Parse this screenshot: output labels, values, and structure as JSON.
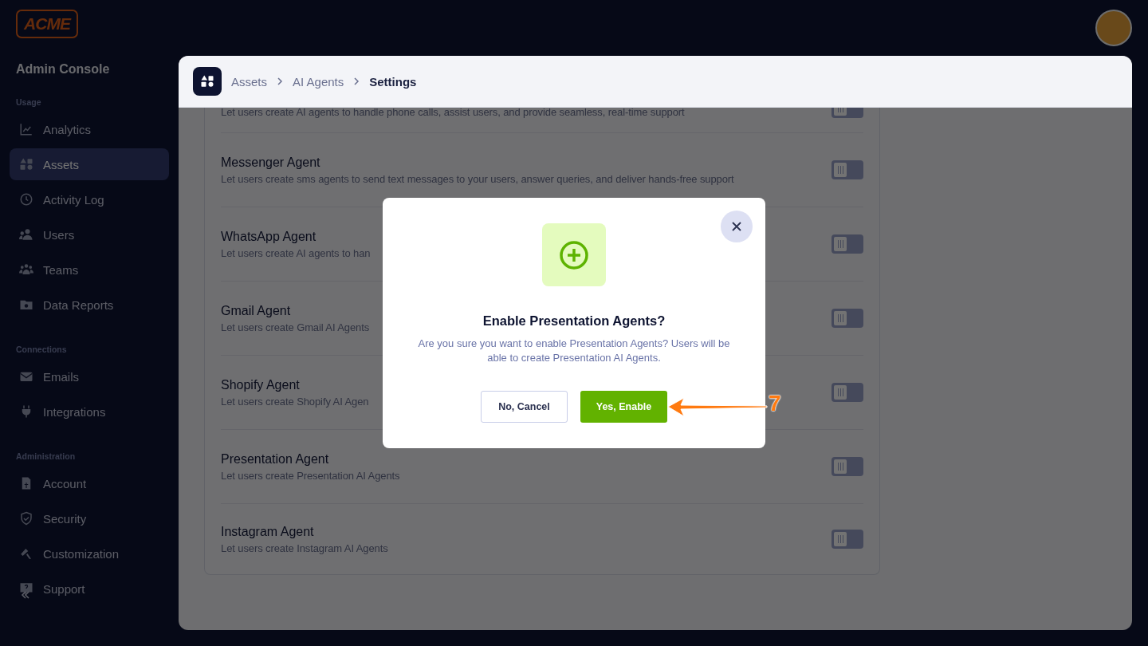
{
  "logo": {
    "text": "ACME"
  },
  "sidebar": {
    "title": "Admin Console",
    "sections": [
      {
        "heading": "Usage",
        "items": [
          {
            "label": "Analytics",
            "selected": false
          },
          {
            "label": "Assets",
            "selected": true
          },
          {
            "label": "Activity Log",
            "selected": false
          },
          {
            "label": "Users",
            "selected": false
          },
          {
            "label": "Teams",
            "selected": false
          },
          {
            "label": "Data Reports",
            "selected": false
          }
        ]
      },
      {
        "heading": "Connections",
        "items": [
          {
            "label": "Emails",
            "selected": false
          },
          {
            "label": "Integrations",
            "selected": false
          }
        ]
      },
      {
        "heading": "Administration",
        "items": [
          {
            "label": "Account",
            "selected": false
          },
          {
            "label": "Security",
            "selected": false
          },
          {
            "label": "Customization",
            "selected": false
          },
          {
            "label": "Support",
            "selected": false
          }
        ]
      }
    ]
  },
  "breadcrumb": [
    {
      "label": "Assets",
      "current": false
    },
    {
      "label": "AI Agents",
      "current": false
    },
    {
      "label": "Settings",
      "current": true
    }
  ],
  "agents": [
    {
      "description": "Let users create AI agents to handle phone calls, assist users, and provide seamless, real-time support",
      "on": false
    },
    {
      "name": "Messenger Agent",
      "description": "Let users create sms agents to send text messages to your users, answer queries, and deliver hands-free support",
      "on": false
    },
    {
      "name": "WhatsApp Agent",
      "description": "Let users create AI agents to han",
      "on": false
    },
    {
      "name": "Gmail Agent",
      "description": "Let users create Gmail AI Agents",
      "on": false
    },
    {
      "name": "Shopify Agent",
      "description": "Let users create Shopify AI Agen",
      "on": false
    },
    {
      "name": "Presentation Agent",
      "description": "Let users create Presentation AI Agents",
      "on": false
    },
    {
      "name": "Instagram Agent",
      "description": "Let users create Instagram AI Agents",
      "on": false
    }
  ],
  "dialog": {
    "title": "Enable Presentation Agents?",
    "message": "Are you sure you want to enable Presentation Agents? Users will be able to create Presentation AI Agents.",
    "cancel": "No, Cancel",
    "confirm": "Yes, Enable"
  },
  "annotation": {
    "label": "7"
  }
}
